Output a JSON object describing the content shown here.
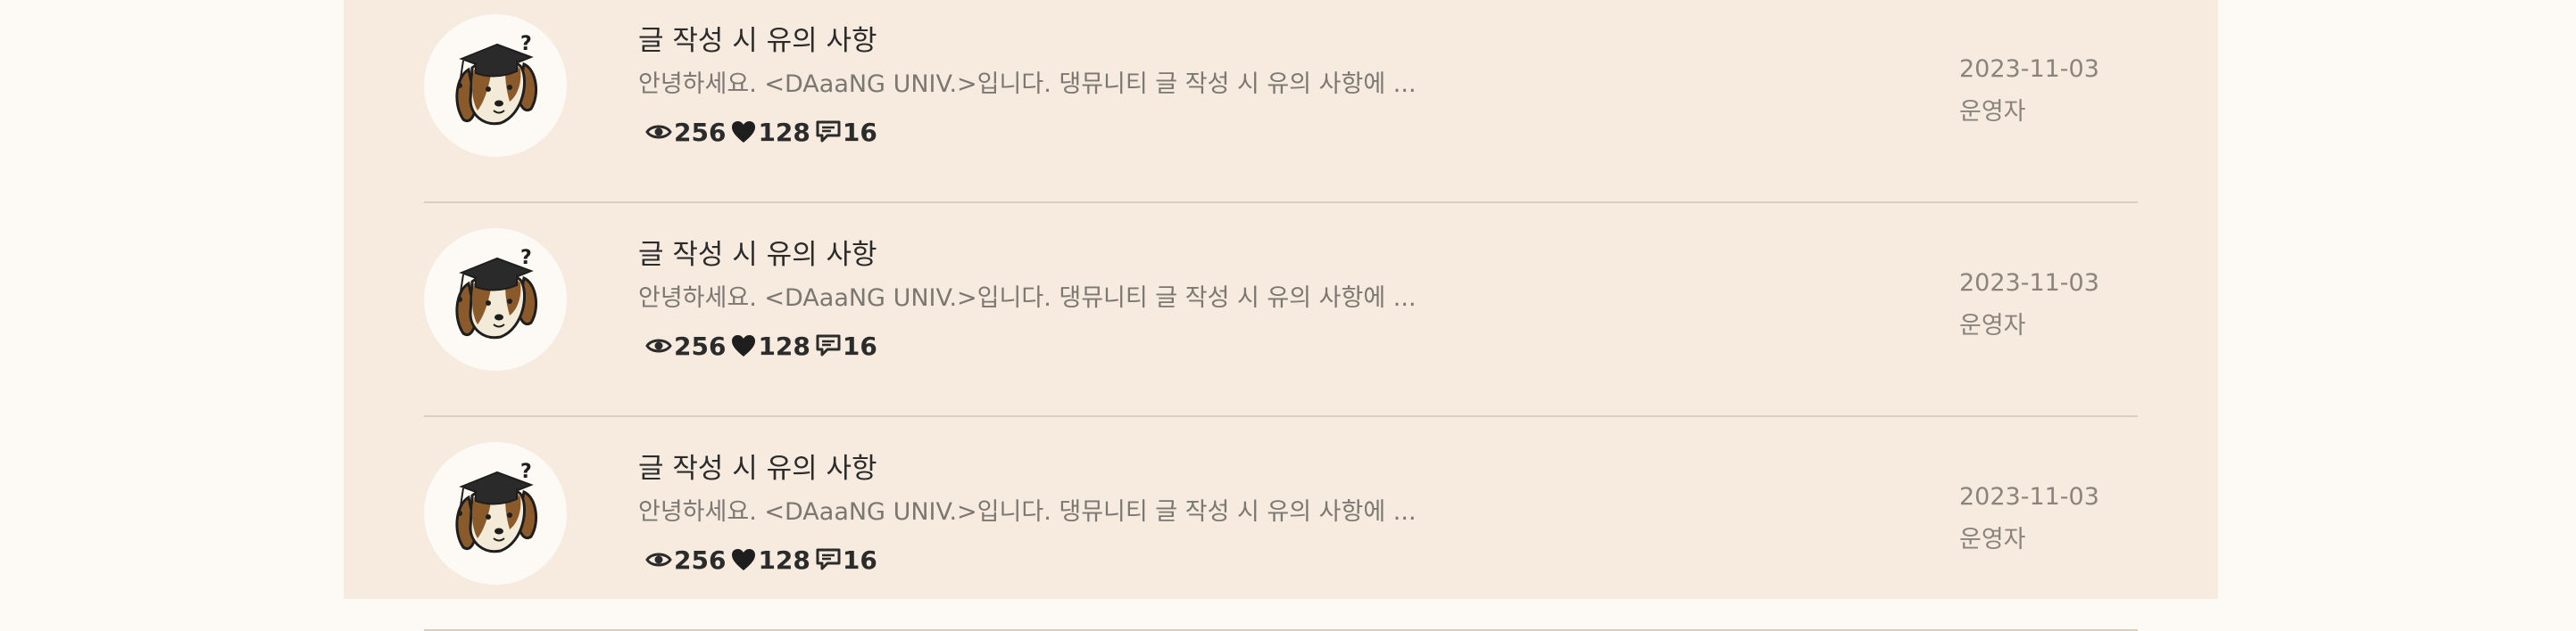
{
  "posts": [
    {
      "title": "글 작성 시 유의 사항",
      "excerpt": "안녕하세요. <DAaaNG UNIV.>입니다. 댕뮤니티 글 작성 시 유의 사항에 ...",
      "views": "256",
      "likes": "128",
      "comments": "16",
      "date": "2023-11-03",
      "author": "운영자",
      "avatar_icon": "graduate-dog-icon"
    },
    {
      "title": "글 작성 시 유의 사항",
      "excerpt": "안녕하세요. <DAaaNG UNIV.>입니다. 댕뮤니티 글 작성 시 유의 사항에 ...",
      "views": "256",
      "likes": "128",
      "comments": "16",
      "date": "2023-11-03",
      "author": "운영자",
      "avatar_icon": "graduate-dog-icon"
    },
    {
      "title": "글 작성 시 유의 사항",
      "excerpt": "안녕하세요. <DAaaNG UNIV.>입니다. 댕뮤니티 글 작성 시 유의 사항에 ...",
      "views": "256",
      "likes": "128",
      "comments": "16",
      "date": "2023-11-03",
      "author": "운영자",
      "avatar_icon": "graduate-dog-icon"
    }
  ],
  "icons": {
    "views": "eye-icon",
    "likes": "heart-icon",
    "comments": "comment-icon"
  },
  "colors": {
    "page_background": "#fdf9f4",
    "panel_background": "#f6ebde",
    "divider": "#d8cec3",
    "text_primary": "#2b2b2b",
    "text_secondary": "#7b7772"
  }
}
